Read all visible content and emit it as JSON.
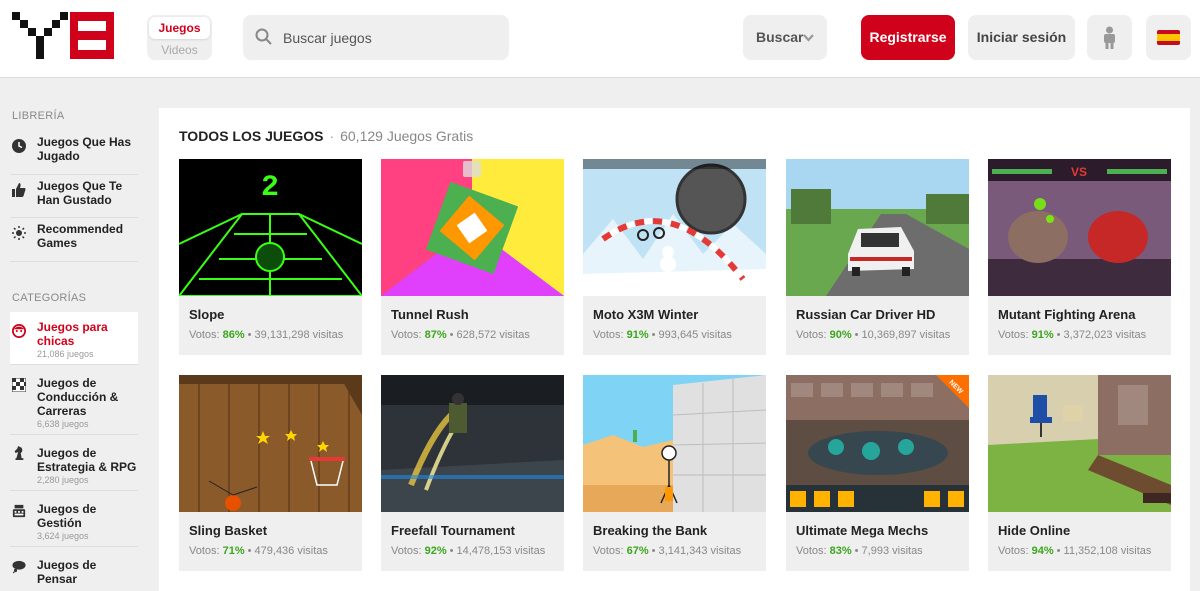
{
  "header": {
    "mode_active": "Juegos",
    "mode_inactive": "Videos",
    "search_placeholder": "Buscar juegos",
    "search_button": "Buscar",
    "register": "Registrarse",
    "login": "Iniciar sesión"
  },
  "sidebar": {
    "library_heading": "LIBRERÍA",
    "library_items": [
      {
        "label": "Juegos Que Has Jugado",
        "icon": "clock-icon"
      },
      {
        "label": "Juegos Que Te Han Gustado",
        "icon": "thumbs-up-icon"
      },
      {
        "label": "Recommended Games",
        "icon": "sun-icon"
      }
    ],
    "categories_heading": "CATEGORÍAS",
    "categories": [
      {
        "label": "Juegos para chicas",
        "count": "21,086 juegos",
        "icon": "girl-face-icon"
      },
      {
        "label": "Juegos de Conducción & Carreras",
        "count": "6,638 juegos",
        "icon": "checkered-flag-icon"
      },
      {
        "label": "Juegos de Estrategia & RPG",
        "count": "2,280 juegos",
        "icon": "chess-knight-icon"
      },
      {
        "label": "Juegos de Gestión",
        "count": "3,624 juegos",
        "icon": "cash-register-icon"
      },
      {
        "label": "Juegos de Pensar",
        "count": "",
        "icon": "thought-bubble-icon"
      }
    ]
  },
  "main": {
    "title": "TODOS LOS JUEGOS",
    "separator": "·",
    "count_text": "60,129 Juegos Gratis",
    "votes_label": "Votos:",
    "visits_suffix": "visitas",
    "games": [
      {
        "name": "Slope",
        "votes": "86%",
        "visits": "39,131,298"
      },
      {
        "name": "Tunnel Rush",
        "votes": "87%",
        "visits": "628,572"
      },
      {
        "name": "Moto X3M Winter",
        "votes": "91%",
        "visits": "993,645"
      },
      {
        "name": "Russian Car Driver HD",
        "votes": "90%",
        "visits": "10,369,897"
      },
      {
        "name": "Mutant Fighting Arena",
        "votes": "91%",
        "visits": "3,372,023"
      },
      {
        "name": "Sling Basket",
        "votes": "71%",
        "visits": "479,436"
      },
      {
        "name": "Freefall Tournament",
        "votes": "92%",
        "visits": "14,478,153"
      },
      {
        "name": "Breaking the Bank",
        "votes": "67%",
        "visits": "3,141,343"
      },
      {
        "name": "Ultimate Mega Mechs",
        "votes": "83%",
        "visits": "7,993"
      },
      {
        "name": "Hide Online",
        "votes": "94%",
        "visits": "11,352,108"
      }
    ]
  },
  "colors": {
    "brand_red": "#d0021b",
    "vote_green": "#3aa71b"
  }
}
